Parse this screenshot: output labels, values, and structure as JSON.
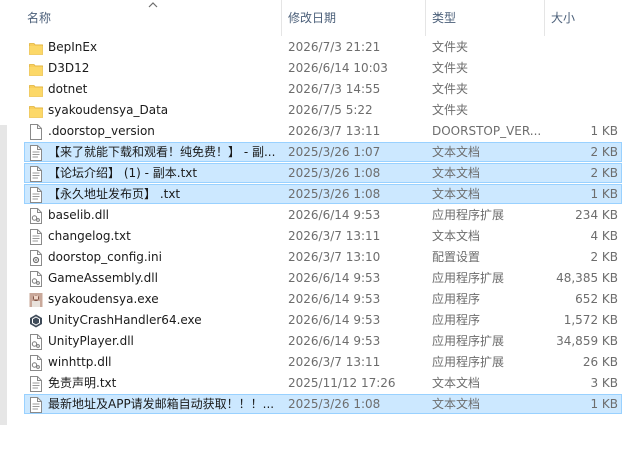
{
  "columns": {
    "name": "名称",
    "date": "修改日期",
    "type": "类型",
    "size": "大小"
  },
  "sort": {
    "column": "name",
    "direction": "ascending"
  },
  "colors": {
    "selected_bg": "#cce8ff",
    "selected_border": "#99d1ff",
    "folder": "#f9cf5c",
    "header_text": "#4c607a"
  },
  "files": [
    {
      "name": "BepInEx",
      "date": "2026/7/3 21:21",
      "type": "文件夹",
      "size": "",
      "icon": "folder-icon",
      "selected": false
    },
    {
      "name": "D3D12",
      "date": "2026/6/14 10:03",
      "type": "文件夹",
      "size": "",
      "icon": "folder-icon",
      "selected": false
    },
    {
      "name": "dotnet",
      "date": "2026/7/3 14:55",
      "type": "文件夹",
      "size": "",
      "icon": "folder-icon",
      "selected": false
    },
    {
      "name": "syakoudensya_Data",
      "date": "2026/7/5 5:22",
      "type": "文件夹",
      "size": "",
      "icon": "folder-icon",
      "selected": false
    },
    {
      "name": ".doorstop_version",
      "date": "2026/3/7 13:11",
      "type": "DOORSTOP_VER...",
      "size": "1 KB",
      "icon": "file-icon",
      "selected": false
    },
    {
      "name": "【来了就能下载和观看！纯免费！】 - 副...",
      "date": "2025/3/26 1:07",
      "type": "文本文档",
      "size": "2 KB",
      "icon": "text-file-icon",
      "selected": true
    },
    {
      "name": "【论坛介绍】 (1) - 副本.txt",
      "date": "2025/3/26 1:08",
      "type": "文本文档",
      "size": "2 KB",
      "icon": "text-file-icon",
      "selected": true
    },
    {
      "name": "【永久地址发布页】 .txt",
      "date": "2025/3/26 1:08",
      "type": "文本文档",
      "size": "1 KB",
      "icon": "text-file-icon",
      "selected": true
    },
    {
      "name": "baselib.dll",
      "date": "2026/6/14 9:53",
      "type": "应用程序扩展",
      "size": "234 KB",
      "icon": "dll-file-icon",
      "selected": false
    },
    {
      "name": "changelog.txt",
      "date": "2026/3/7 13:11",
      "type": "文本文档",
      "size": "4 KB",
      "icon": "text-file-icon",
      "selected": false
    },
    {
      "name": "doorstop_config.ini",
      "date": "2026/3/7 13:10",
      "type": "配置设置",
      "size": "2 KB",
      "icon": "config-file-icon",
      "selected": false
    },
    {
      "name": "GameAssembly.dll",
      "date": "2026/6/14 9:53",
      "type": "应用程序扩展",
      "size": "48,385 KB",
      "icon": "dll-file-icon",
      "selected": false
    },
    {
      "name": "syakoudensya.exe",
      "date": "2026/6/14 9:53",
      "type": "应用程序",
      "size": "652 KB",
      "icon": "app-icon",
      "selected": false
    },
    {
      "name": "UnityCrashHandler64.exe",
      "date": "2026/6/14 9:53",
      "type": "应用程序",
      "size": "1,572 KB",
      "icon": "unity-icon",
      "selected": false
    },
    {
      "name": "UnityPlayer.dll",
      "date": "2026/6/14 9:53",
      "type": "应用程序扩展",
      "size": "34,859 KB",
      "icon": "dll-file-icon",
      "selected": false
    },
    {
      "name": "winhttp.dll",
      "date": "2026/3/7 13:11",
      "type": "应用程序扩展",
      "size": "26 KB",
      "icon": "dll-file-icon",
      "selected": false
    },
    {
      "name": "免责声明.txt",
      "date": "2025/11/12 17:26",
      "type": "文本文档",
      "size": "3 KB",
      "icon": "text-file-icon",
      "selected": false
    },
    {
      "name": "最新地址及APP请发邮箱自动获取！！！...",
      "date": "2025/3/26 1:08",
      "type": "文本文档",
      "size": "1 KB",
      "icon": "text-file-icon",
      "selected": true
    }
  ]
}
